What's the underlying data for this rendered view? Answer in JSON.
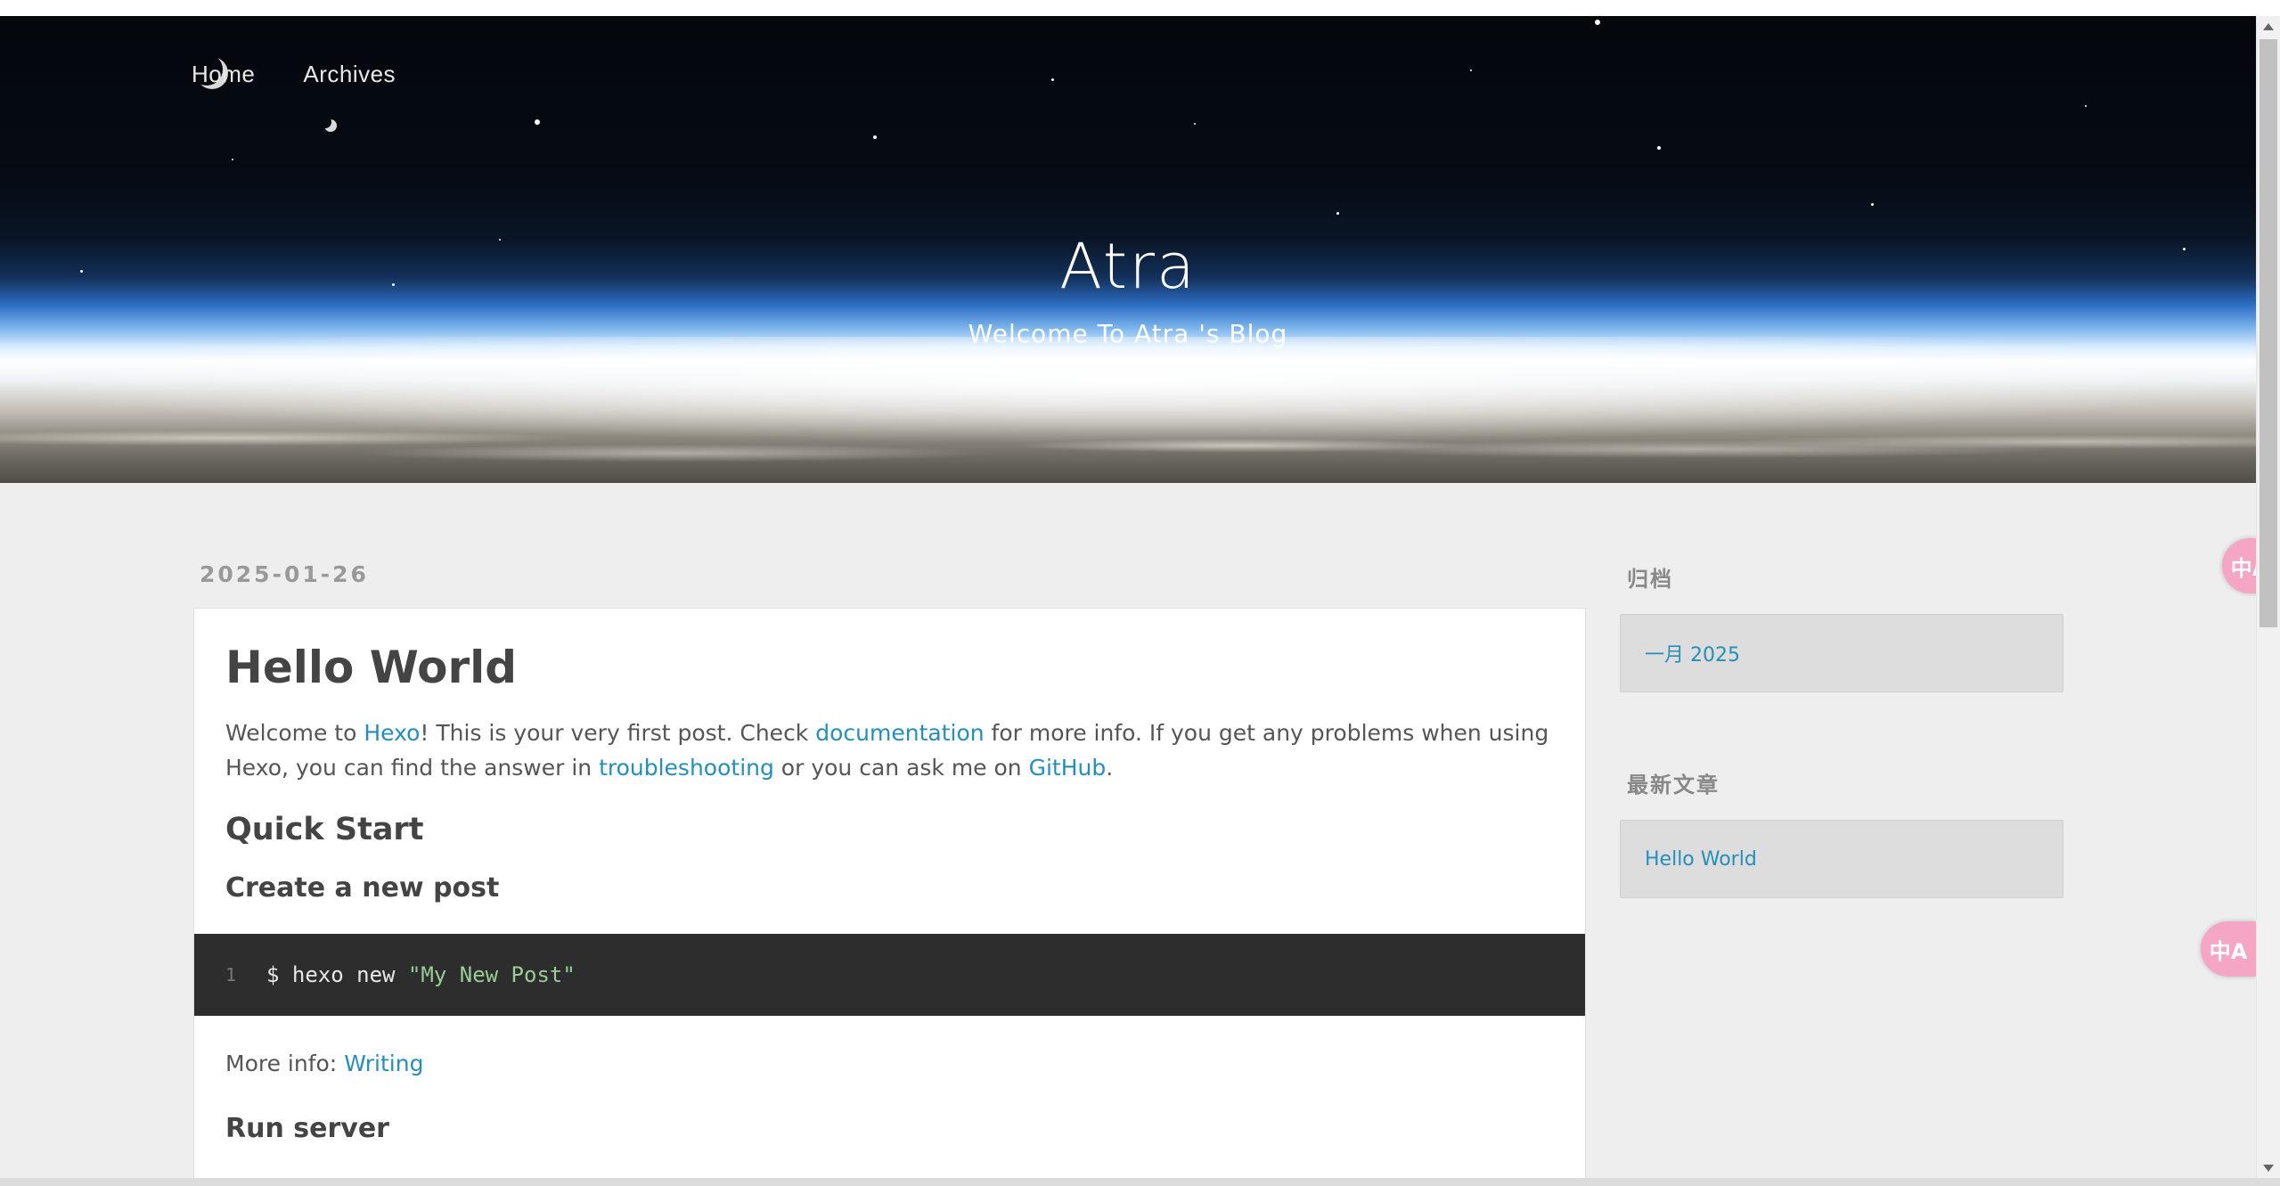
{
  "nav": {
    "items": [
      {
        "label": "Home"
      },
      {
        "label": "Archives"
      }
    ]
  },
  "header": {
    "title": "Atra",
    "subtitle": "Welcome To Atra 's Blog"
  },
  "post": {
    "date": "2025-01-26",
    "title": "Hello World",
    "intro": {
      "t1": "Welcome to ",
      "link1": "Hexo",
      "t2": "! This is your very first post. Check ",
      "link2": "documentation",
      "t3": " for more info. If you get any problems when using Hexo, you can find the answer in ",
      "link3": "troubleshooting",
      "t4": " or you can ask me on ",
      "link4": "GitHub",
      "t5": "."
    },
    "h2_quick_start": "Quick Start",
    "h3_create_post": "Create a new post",
    "code": {
      "line_number": "1",
      "command": "$ hexo new ",
      "string": "\"My New Post\""
    },
    "more_info": {
      "text": "More info: ",
      "link": "Writing"
    },
    "h3_run_server": "Run server"
  },
  "sidebar": {
    "archive_title": "归档",
    "archive_item": "一月 2025",
    "recent_title": "最新文章",
    "recent_item": "Hello World"
  },
  "translate_button": {
    "icon": "translate-icon",
    "glyph": "中A"
  },
  "colors": {
    "link": "#258fb8",
    "background": "#eeeeee",
    "code_bg": "#2d2d2d",
    "translate_button": "#f4a6c4"
  }
}
